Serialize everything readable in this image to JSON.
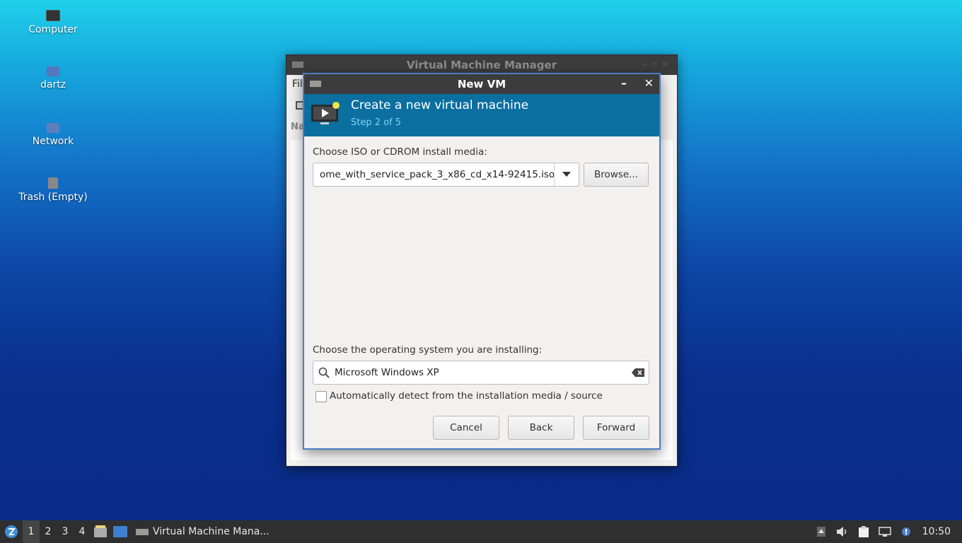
{
  "desktop": {
    "icons": [
      {
        "label": "Computer",
        "icon": "computer-icon"
      },
      {
        "label": "dartz",
        "icon": "home-folder-icon"
      },
      {
        "label": "Network",
        "icon": "network-icon"
      },
      {
        "label": "Trash (Empty)",
        "icon": "trash-icon"
      }
    ]
  },
  "vmm_window": {
    "title": "Virtual Machine Manager",
    "menu_first": "Fil",
    "column_header": "Na"
  },
  "dialog": {
    "title": "New VM",
    "banner_title": "Create a new virtual machine",
    "banner_step": "Step 2 of 5",
    "media_label": "Choose ISO or CDROM install media:",
    "media_value": "ome_with_service_pack_3_x86_cd_x14-92415.iso",
    "browse_label": "Browse...",
    "os_label": "Choose the operating system you are installing:",
    "os_value": "Microsoft Windows XP",
    "auto_detect_label": "Automatically detect from the installation media / source",
    "auto_detect_checked": false,
    "cancel_label": "Cancel",
    "back_label": "Back",
    "forward_label": "Forward"
  },
  "taskbar": {
    "workspaces": [
      "1",
      "2",
      "3",
      "4"
    ],
    "active_workspace": "1",
    "app_label": "Virtual Machine Mana...",
    "clock": "10:50"
  },
  "colors": {
    "banner": "#0b6fa0",
    "dialog_border": "#4c7dc6",
    "titlebar": "#3c3c3c"
  }
}
